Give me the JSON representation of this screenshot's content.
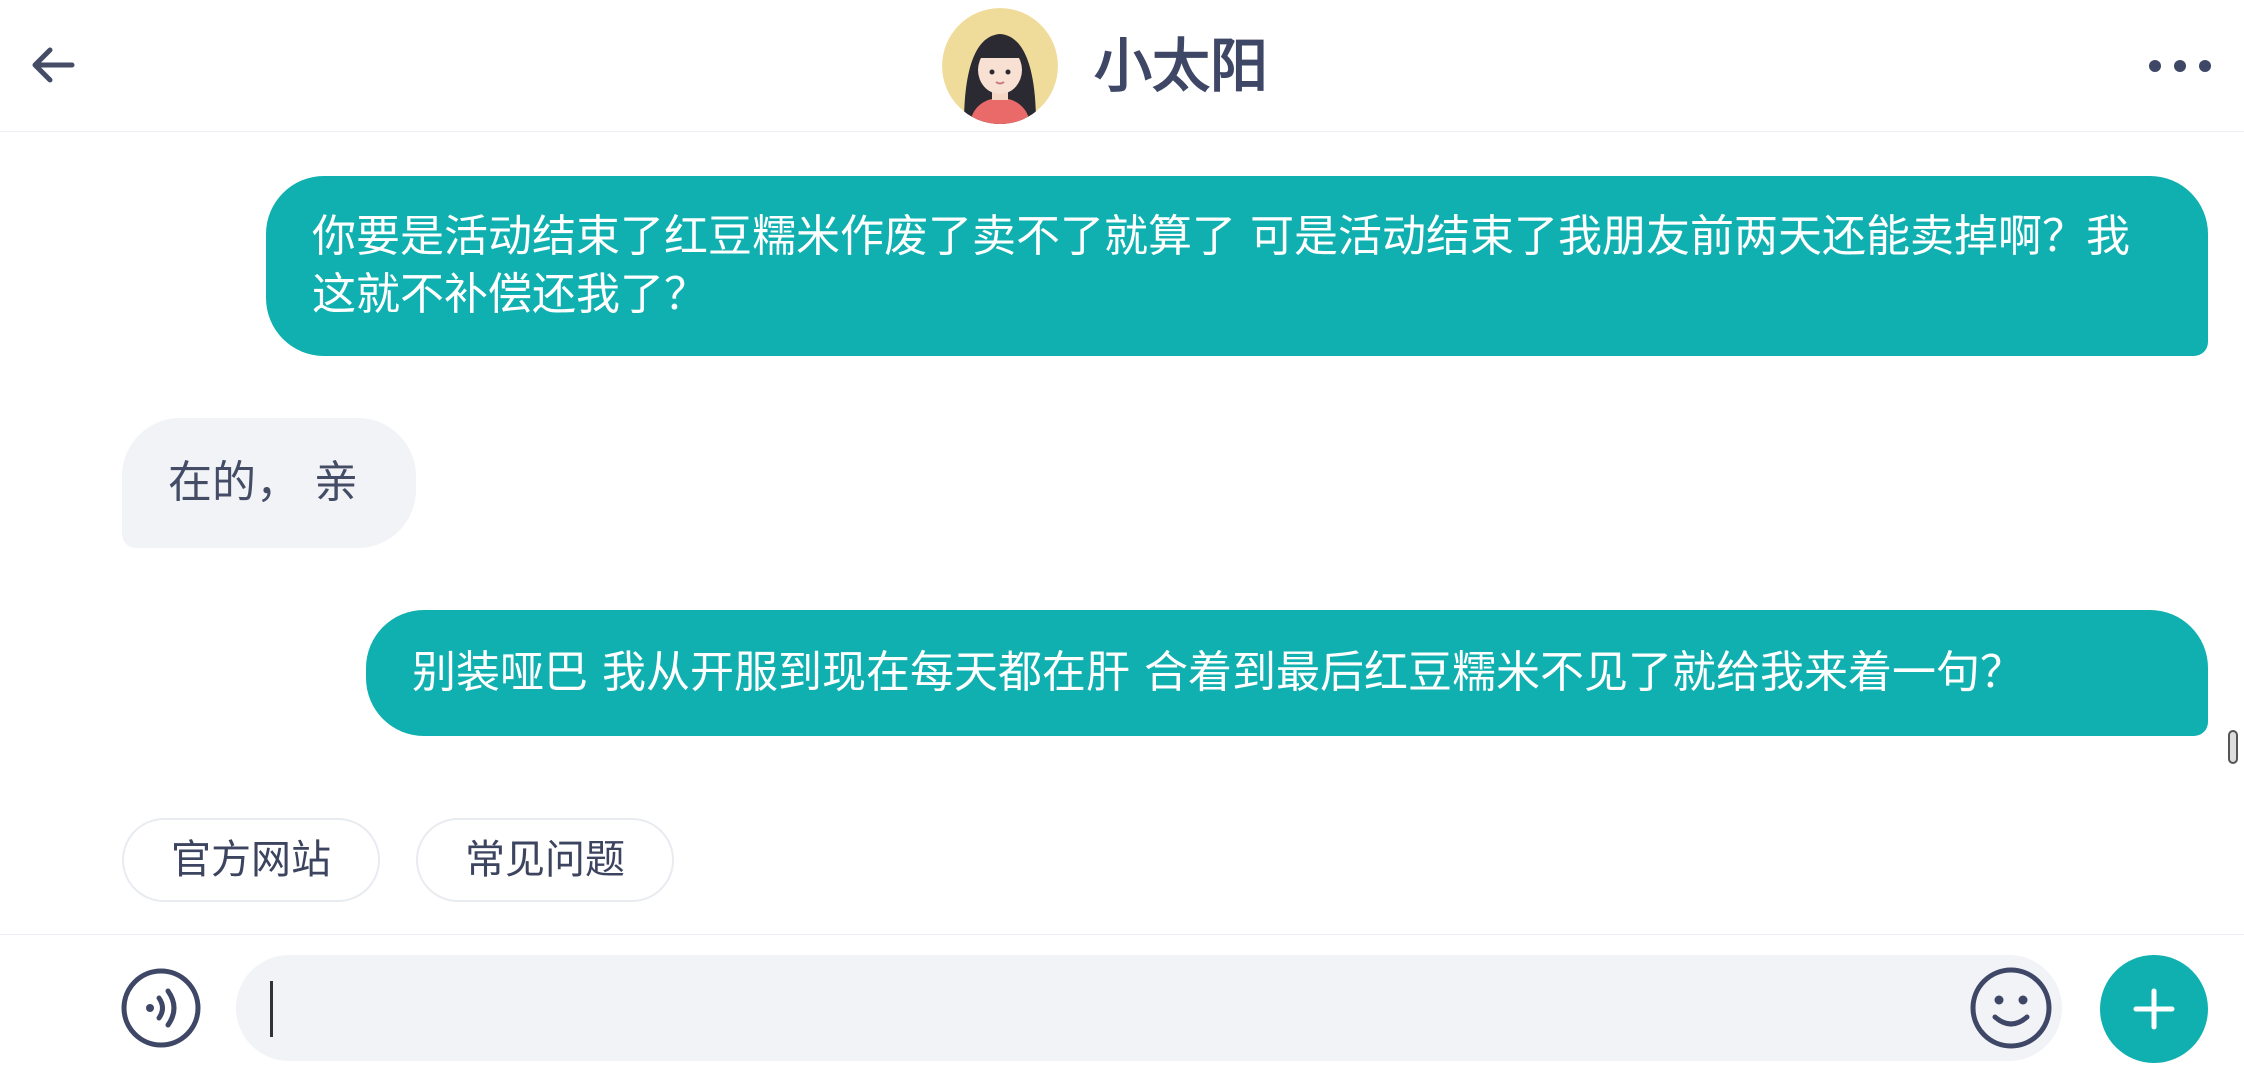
{
  "header": {
    "title": "小太阳",
    "back_icon": "arrow-left-icon",
    "more_icon": "more-horizontal-icon",
    "avatar": "avatar"
  },
  "messages": [
    {
      "side": "outgoing",
      "text": "你要是活动结束了红豆糯米作废了卖不了就算了 可是活动结束了我朋友前两天还能卖掉啊？我这就不补偿还我了？"
    },
    {
      "side": "incoming",
      "text": "在的， 亲"
    },
    {
      "side": "outgoing",
      "text": "别装哑巴 我从开服到现在每天都在肝 合着到最后红豆糯米不见了就给我来着一句？"
    }
  ],
  "quick_replies": [
    "官方网站",
    "常见问题"
  ],
  "input": {
    "value": "",
    "placeholder": "",
    "voice_icon": "voice-icon",
    "emoji_icon": "emoji-icon",
    "plus_icon": "plus-icon"
  },
  "colors": {
    "accent": "#10b0b0",
    "incoming_bubble": "#f1f3f7",
    "title_text": "#3f4766"
  }
}
